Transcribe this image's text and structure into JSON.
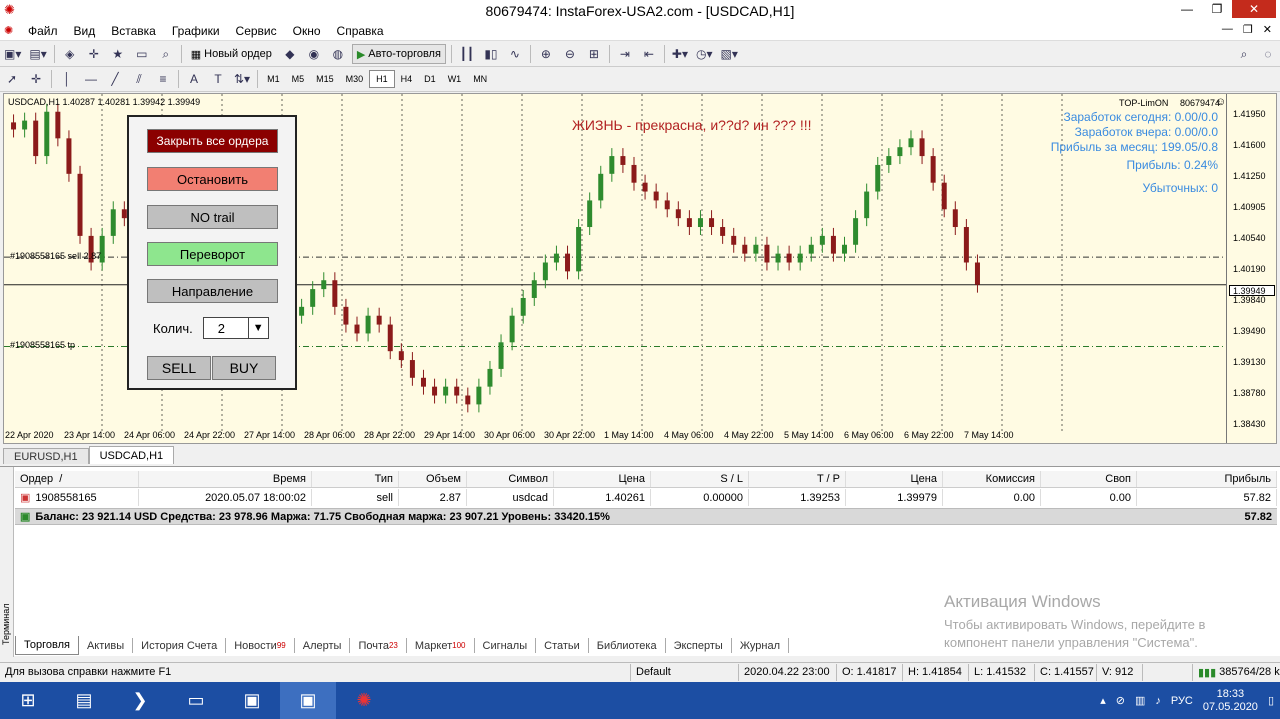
{
  "window": {
    "title": "80679474: InstaForex-USA2.com - [USDCAD,H1]",
    "logo_icon": "instaforex-logo-icon"
  },
  "menu": [
    "Файл",
    "Вид",
    "Вставка",
    "Графики",
    "Сервис",
    "Окно",
    "Справка"
  ],
  "toolbar": {
    "new_order": "Новый ордер",
    "auto_trading": "Авто-торговля"
  },
  "timeframes": [
    "M1",
    "M5",
    "M15",
    "M30",
    "H1",
    "H4",
    "D1",
    "W1",
    "MN"
  ],
  "timeframe_active": "H1",
  "chart": {
    "header": "USDCAD,H1  1.40287 1.40281 1.39942 1.39949",
    "expert": "TOP-LimON",
    "account_short": "80679474",
    "headline": "ЖИЗНЬ - прекрасна, и??d? ин ??? !!!",
    "info": [
      "Заработок сегодня: 0.00/0.0",
      "Заработок вчера: 0.00/0.0",
      "Прибыль за месяц: 199.05/0.8",
      "Прибыль: 0.24%",
      "Убыточных: 0"
    ],
    "order_sl_label": "#1908558165 sell 2.87",
    "order_tp_label": "#1908558165 tp",
    "price_labels": [
      "1.41950",
      "1.41600",
      "1.41250",
      "1.40905",
      "1.40540",
      "1.40190",
      "1.39840",
      "1.39490",
      "1.39130",
      "1.38780",
      "1.38430"
    ],
    "current_price": "1.39949",
    "time_labels": [
      "22 Apr 2020",
      "23 Apr 14:00",
      "24 Apr 06:00",
      "24 Apr 22:00",
      "27 Apr 14:00",
      "28 Apr 06:00",
      "28 Apr 22:00",
      "29 Apr 14:00",
      "30 Apr 06:00",
      "30 Apr 22:00",
      "1 May 14:00",
      "4 May 06:00",
      "4 May 22:00",
      "5 May 14:00",
      "6 May 06:00",
      "6 May 22:00",
      "7 May 14:00"
    ],
    "colors": {
      "background": "#fffbe3",
      "bull": "#2e8b2e",
      "bear": "#8b1a1a",
      "info": "#3a8be0",
      "headline": "#b22222"
    }
  },
  "chart_data": {
    "type": "candlestick",
    "symbol": "USDCAD",
    "timeframe": "H1",
    "ylim": [
      1.383,
      1.421
    ],
    "current_price": 1.39949,
    "order_open_level": 1.40261,
    "tp_level": 1.39253,
    "closes": [
      1.417,
      1.418,
      1.414,
      1.419,
      1.416,
      1.412,
      1.405,
      1.402,
      1.405,
      1.408,
      1.407,
      1.409,
      1.406,
      1.404,
      1.405,
      1.407,
      1.403,
      1.401,
      1.4,
      1.402,
      1.405,
      1.406,
      1.404,
      1.401,
      1.399,
      1.396,
      1.397,
      1.399,
      1.4,
      1.397,
      1.395,
      1.394,
      1.396,
      1.395,
      1.392,
      1.391,
      1.389,
      1.388,
      1.387,
      1.388,
      1.387,
      1.386,
      1.388,
      1.39,
      1.393,
      1.396,
      1.398,
      1.4,
      1.402,
      1.403,
      1.401,
      1.406,
      1.409,
      1.412,
      1.414,
      1.413,
      1.411,
      1.41,
      1.409,
      1.408,
      1.407,
      1.406,
      1.407,
      1.406,
      1.405,
      1.404,
      1.403,
      1.404,
      1.402,
      1.403,
      1.402,
      1.403,
      1.404,
      1.405,
      1.403,
      1.404,
      1.407,
      1.41,
      1.413,
      1.414,
      1.415,
      1.416,
      1.414,
      1.411,
      1.408,
      1.406,
      1.402,
      1.3995
    ]
  },
  "panel": {
    "close_all": "Закрыть все ордера",
    "stop": "Остановить",
    "no_trail": "NO trail",
    "reverse": "Переворот",
    "direction": "Направление",
    "qty_label": "Колич.",
    "qty_value": "2",
    "sell": "SELL",
    "buy": "BUY"
  },
  "chart_tabs": [
    "EURUSD,H1",
    "USDCAD,H1"
  ],
  "terminal": {
    "side_label": "Терминал",
    "headers": [
      "Ордер",
      "Время",
      "Тип",
      "Объем",
      "Символ",
      "Цена",
      "S / L",
      "T / P",
      "Цена",
      "Комиссия",
      "Своп",
      "Прибыль"
    ],
    "row": [
      "1908558165",
      "2020.05.07 18:00:02",
      "sell",
      "2.87",
      "usdcad",
      "1.40261",
      "0.00000",
      "1.39253",
      "1.39979",
      "0.00",
      "0.00",
      "57.82"
    ],
    "balance": "Баланс: 23 921.14 USD  Средства: 23 978.96  Маржа: 71.75  Свободная маржа: 23 907.21  Уровень: 33420.15%",
    "balance_profit": "57.82",
    "tabs": [
      {
        "label": "Торговля",
        "badge": ""
      },
      {
        "label": "Активы",
        "badge": ""
      },
      {
        "label": "История Счета",
        "badge": ""
      },
      {
        "label": "Новости",
        "badge": "99"
      },
      {
        "label": "Алерты",
        "badge": ""
      },
      {
        "label": "Почта",
        "badge": "23"
      },
      {
        "label": "Маркет",
        "badge": "100"
      },
      {
        "label": "Сигналы",
        "badge": ""
      },
      {
        "label": "Статьи",
        "badge": ""
      },
      {
        "label": "Библиотека",
        "badge": ""
      },
      {
        "label": "Эксперты",
        "badge": ""
      },
      {
        "label": "Журнал",
        "badge": ""
      }
    ]
  },
  "activation": {
    "title": "Активация Windows",
    "line1": "Чтобы активировать Windows, перейдите в",
    "line2": "компонент панели управления \"Система\"."
  },
  "status": {
    "help": "Для вызова справки нажмите F1",
    "profile": "Default",
    "datetime": "2020.04.22 23:00",
    "open": "O: 1.41817",
    "high": "H: 1.41854",
    "low": "L: 1.41532",
    "close": "C: 1.41557",
    "volume": "V: 912",
    "traffic": "385764/28 kb"
  },
  "tray": {
    "lang": "РУС",
    "time": "18:33",
    "date": "07.05.2020"
  }
}
